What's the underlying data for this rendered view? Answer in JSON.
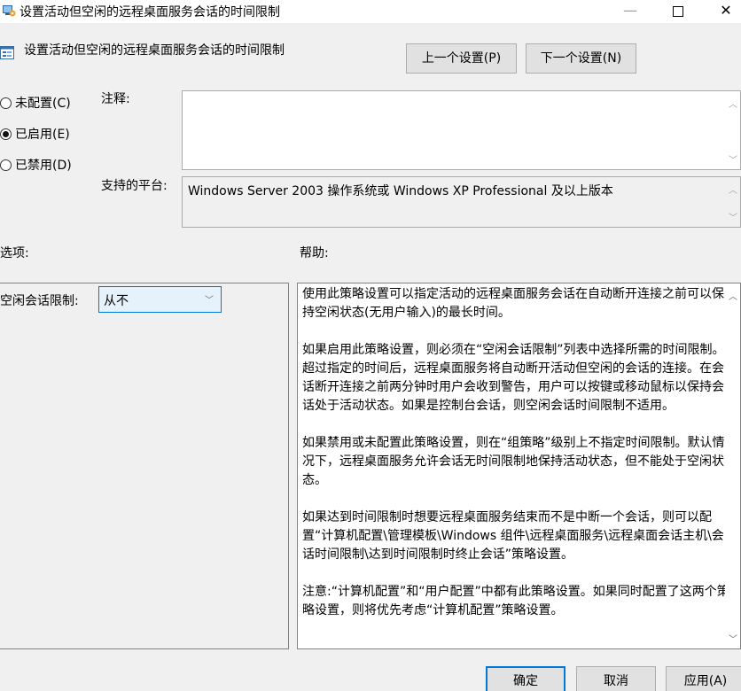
{
  "window": {
    "title": "设置活动但空闲的远程桌面服务会话的时间限制",
    "icon": "policy-settings-icon",
    "minimize_glyph": "—",
    "close_glyph": "✕"
  },
  "header": {
    "setting_name": "设置活动但空闲的远程桌面服务会话的时间限制",
    "prev_button": "上一个设置(P)",
    "next_button": "下一个设置(N)"
  },
  "state": {
    "options": [
      {
        "label": "未配置(C)",
        "checked": false
      },
      {
        "label": "已启用(E)",
        "checked": true
      },
      {
        "label": "已禁用(D)",
        "checked": false
      }
    ]
  },
  "comment": {
    "label": "注释:",
    "value": ""
  },
  "platform": {
    "label": "支持的平台:",
    "value": "Windows Server 2003 操作系统或 Windows XP Professional 及以上版本"
  },
  "options_section": {
    "label": "选项:",
    "field_label": "空闲会话限制:",
    "selected_value": "从不"
  },
  "help_section": {
    "label": "帮助:",
    "paragraphs": [
      "使用此策略设置可以指定活动的远程桌面服务会话在自动断开连接之前可以保持空闲状态(无用户输入)的最长时间。",
      "如果启用此策略设置，则必须在“空闲会话限制”列表中选择所需的时间限制。超过指定的时间后，远程桌面服务将自动断开活动但空闲的会话的连接。在会话断开连接之前两分钟时用户会收到警告，用户可以按键或移动鼠标以保持会话处于活动状态。如果是控制台会话，则空闲会话时间限制不适用。",
      "如果禁用或未配置此策略设置，则在“组策略”级别上不指定时间限制。默认情况下，远程桌面服务允许会话无时间限制地保持活动状态，但不能处于空闲状态。",
      "如果达到时间限制时想要远程桌面服务结束而不是中断一个会话，则可以配置“计算机配置\\管理模板\\Windows 组件\\远程桌面服务\\远程桌面会话主机\\会话时间限制\\达到时间限制时终止会话”策略设置。",
      "注意:“计算机配置”和“用户配置”中都有此策略设置。如果同时配置了这两个策略设置，则将优先考虑“计算机配置”策略设置。"
    ]
  },
  "footer": {
    "ok": "确定",
    "cancel": "取消",
    "apply": "应用(A)"
  },
  "colors": {
    "accent": "#0078d7",
    "background": "#f0f0f0"
  }
}
